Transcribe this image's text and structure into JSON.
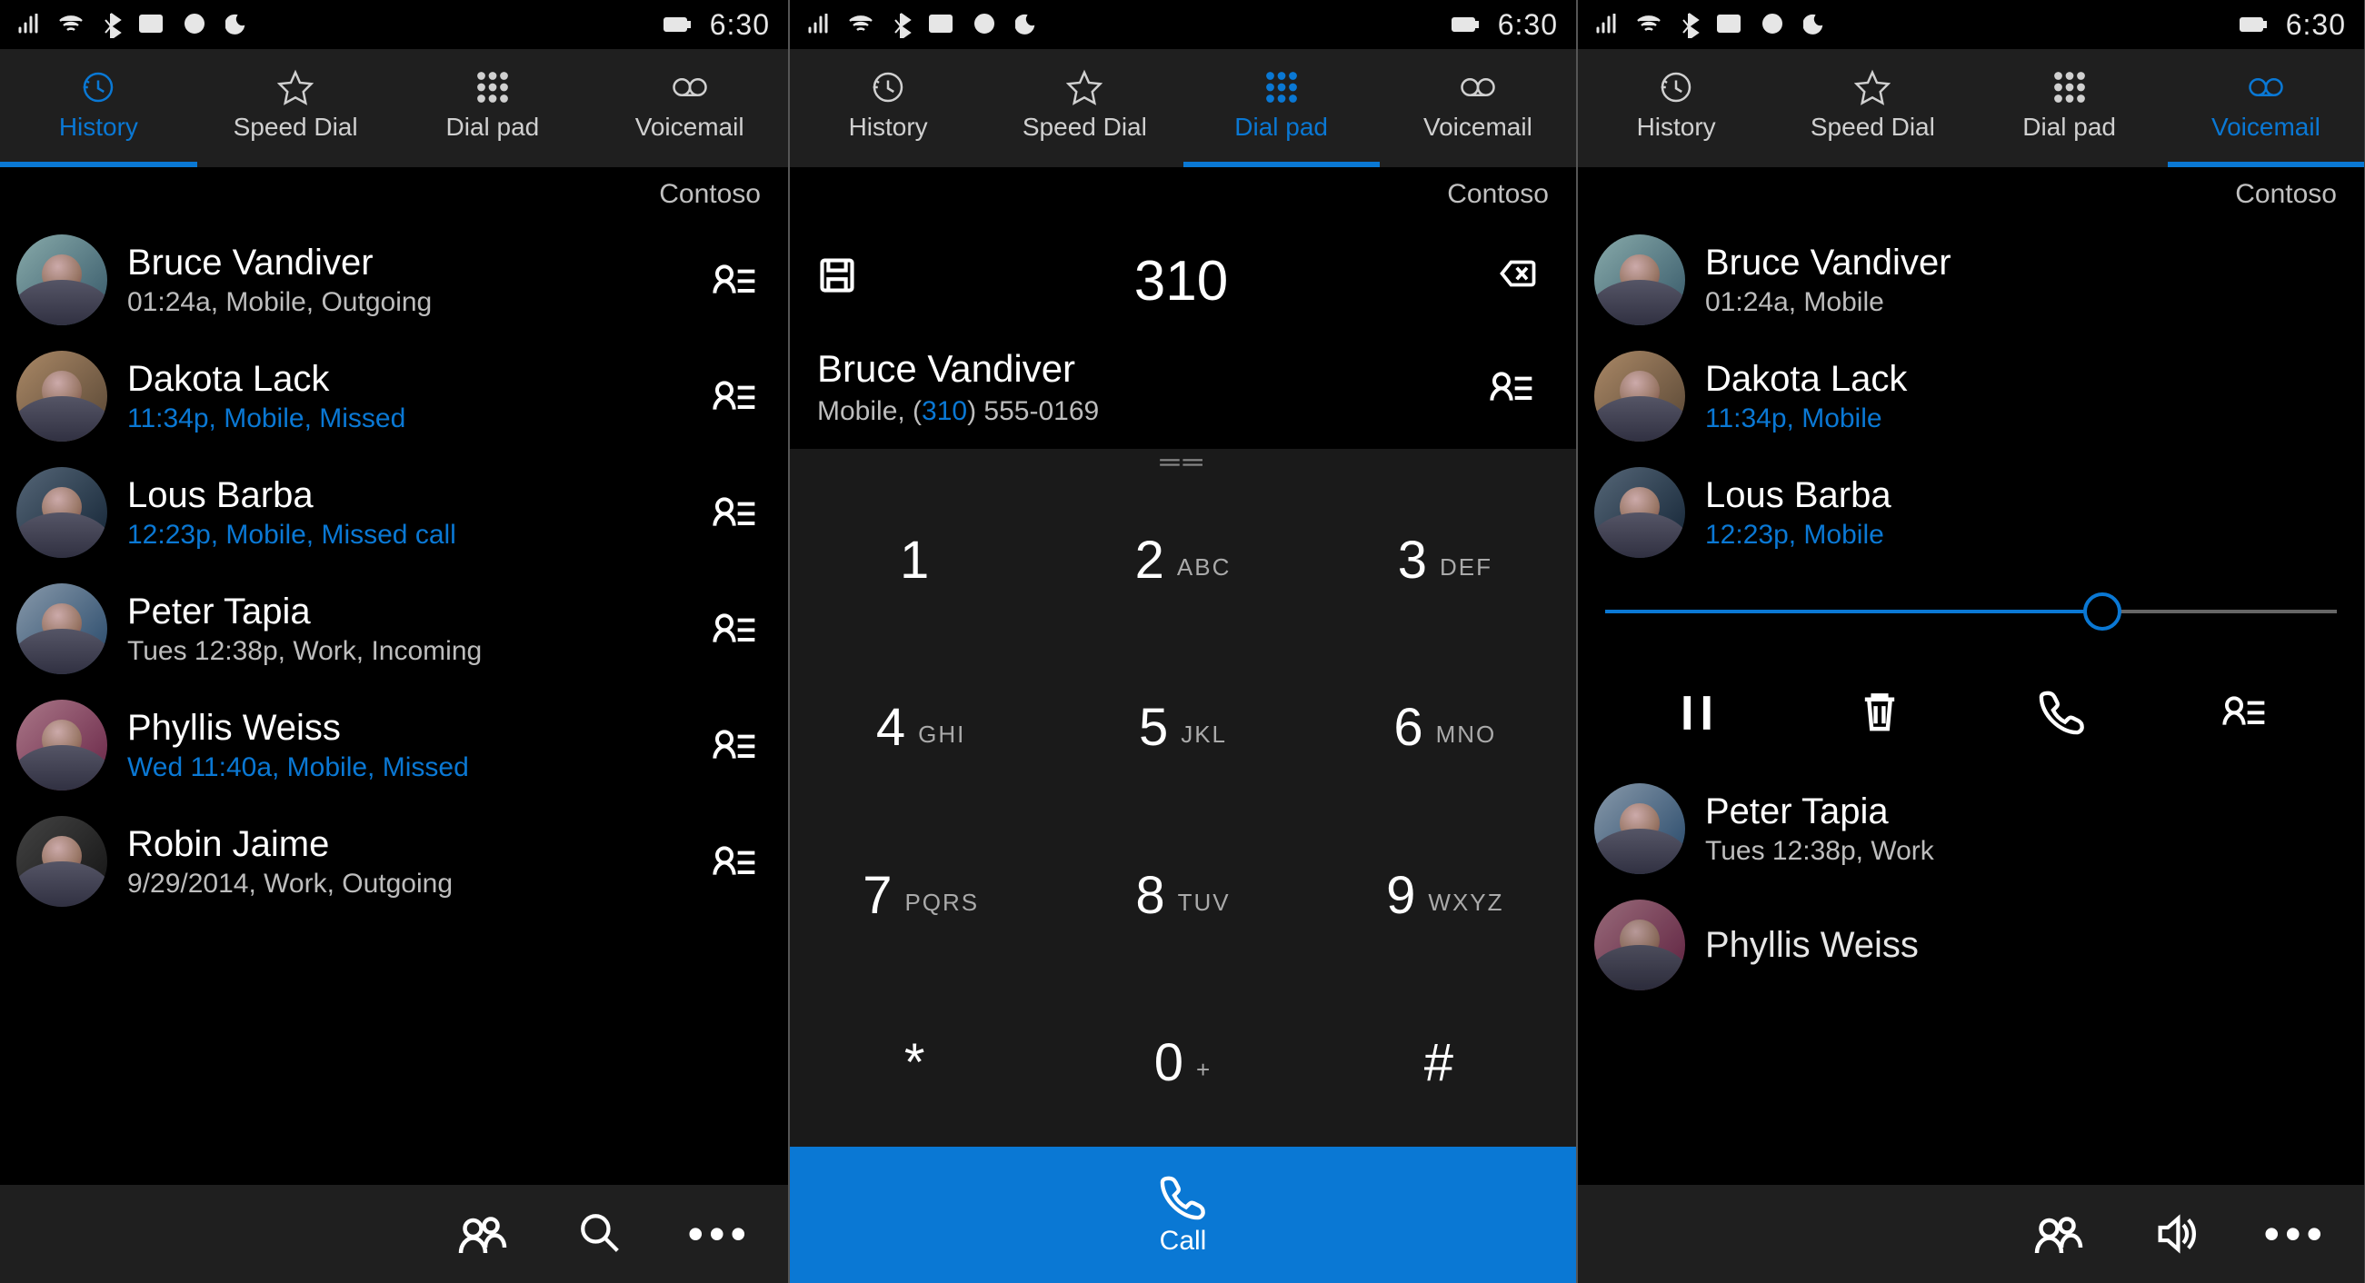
{
  "status": {
    "time": "6:30"
  },
  "tabs": [
    {
      "label": "History"
    },
    {
      "label": "Speed Dial"
    },
    {
      "label": "Dial pad"
    },
    {
      "label": "Voicemail"
    }
  ],
  "operator": "Contoso",
  "screens": {
    "history": {
      "active_tab": 0,
      "entries": [
        {
          "name": "Bruce Vandiver",
          "sub": "01:24a, Mobile, Outgoing",
          "accent": false
        },
        {
          "name": "Dakota Lack",
          "sub": "11:34p, Mobile, Missed",
          "accent": true
        },
        {
          "name": "Lous Barba",
          "sub": "12:23p, Mobile, Missed call",
          "accent": true
        },
        {
          "name": "Peter Tapia",
          "sub": "Tues 12:38p, Work, Incoming",
          "accent": false
        },
        {
          "name": "Phyllis Weiss",
          "sub": "Wed 11:40a, Mobile, Missed",
          "accent": true
        },
        {
          "name": "Robin Jaime",
          "sub": "9/29/2014, Work, Outgoing",
          "accent": false
        }
      ]
    },
    "dialpad": {
      "active_tab": 2,
      "entered_number": "310",
      "match": {
        "name": "Bruce Vandiver",
        "number_prefix": "Mobile, (",
        "number_highlight": "310",
        "number_rest": ") 555-0169"
      },
      "keys": [
        {
          "digit": "1",
          "letters": ""
        },
        {
          "digit": "2",
          "letters": "ABC"
        },
        {
          "digit": "3",
          "letters": "DEF"
        },
        {
          "digit": "4",
          "letters": "GHI"
        },
        {
          "digit": "5",
          "letters": "JKL"
        },
        {
          "digit": "6",
          "letters": "MNO"
        },
        {
          "digit": "7",
          "letters": "PQRS"
        },
        {
          "digit": "8",
          "letters": "TUV"
        },
        {
          "digit": "9",
          "letters": "WXYZ"
        },
        {
          "digit": "*",
          "letters": ""
        },
        {
          "digit": "0",
          "letters": "+"
        },
        {
          "digit": "#",
          "letters": ""
        }
      ],
      "call_label": "Call"
    },
    "voicemail": {
      "active_tab": 3,
      "progress_percent": 68,
      "entries_top": [
        {
          "name": "Bruce Vandiver",
          "sub": "01:24a, Mobile",
          "accent": false
        },
        {
          "name": "Dakota Lack",
          "sub": "11:34p, Mobile",
          "accent": true
        },
        {
          "name": "Lous Barba",
          "sub": "12:23p, Mobile",
          "accent": true
        }
      ],
      "entries_bottom": [
        {
          "name": "Peter Tapia",
          "sub": "Tues 12:38p, Work",
          "accent": false
        },
        {
          "name": "Phyllis Weiss",
          "sub": "",
          "accent": false
        }
      ]
    }
  }
}
